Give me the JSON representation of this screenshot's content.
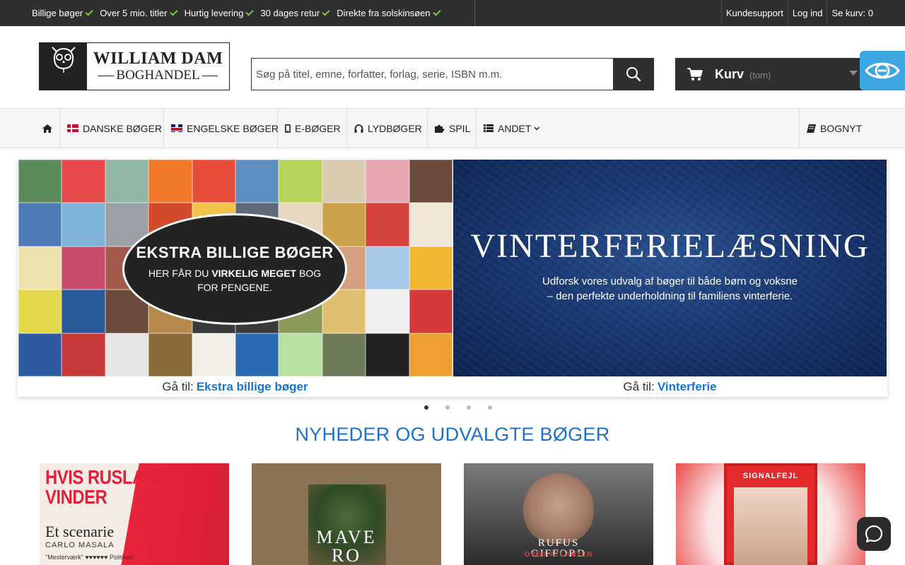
{
  "topbar": {
    "usps": [
      "Billige bøger",
      "Over 5 mio. titler",
      "Hurtig levering",
      "30 dages retur",
      "Direkte fra solskinsøen"
    ],
    "links": {
      "support": "Kundesupport",
      "login": "Log ind",
      "cart": "Se kurv: 0"
    }
  },
  "logo": {
    "name": "WILLIAM DAM",
    "sub": "BOGHANDEL",
    "mark": "WD"
  },
  "search": {
    "placeholder": "Søg på titel, emne, forfatter, forlag, serie, ISBN m.m."
  },
  "cart": {
    "label": "Kurv",
    "status": "(tom)"
  },
  "nav": {
    "home_icon": "home-icon",
    "items": [
      {
        "label": "DANSKE BØGER",
        "icon": "danish-flag-icon"
      },
      {
        "label": "ENGELSKE BØGER",
        "icon": "uk-flag-icon"
      },
      {
        "label": "E-BØGER",
        "icon": "tablet-icon"
      },
      {
        "label": "LYDBØGER",
        "icon": "headphones-icon"
      },
      {
        "label": "SPIL",
        "icon": "puzzle-icon"
      },
      {
        "label": "ANDET",
        "icon": "list-icon"
      },
      {
        "label": "BOGNYT",
        "icon": "book-icon"
      }
    ]
  },
  "slider": {
    "left": {
      "title": "EKSTRA BILLIGE BØGER",
      "sub_pre": "HER FÅR DU ",
      "sub_bold": "VIRKELIG MEGET",
      "sub_post": " BOG FOR PENGENE.",
      "caption_prefix": "Gå til:",
      "caption_link": "Ekstra billige bøger"
    },
    "right": {
      "title": "VINTERFERIELÆSNING",
      "sub_line1": "Udforsk vores udvalg af bøger til både børn og voksne",
      "sub_line2": "– den perfekte underholdning til familiens vinterferie.",
      "caption_prefix": "Gå til:",
      "caption_link": "Vinterferie"
    },
    "dots": 4,
    "active_dot": 0
  },
  "section": {
    "title": "NYHEDER OG UDVALGTE BØGER"
  },
  "products": [
    {
      "line1": "HVIS RUSLAND",
      "line2": "VINDER",
      "line3": "Et scenarie",
      "author": "CARLO MASALA",
      "quote": "\"Mesterværk\" ♥♥♥♥♥♥ Politiken"
    },
    {
      "title1": "MAVE",
      "title2": "RO"
    },
    {
      "title1": "RUFUS",
      "title2": "GIFFORD",
      "subtitle": "OVER ATLANTEN"
    },
    {
      "title": "SIGNALFEJL"
    }
  ],
  "colors": {
    "accent": "#1a73c8",
    "dark": "#2f2f2f",
    "check": "#7ac943",
    "accessibility": "#3ba6e0"
  }
}
